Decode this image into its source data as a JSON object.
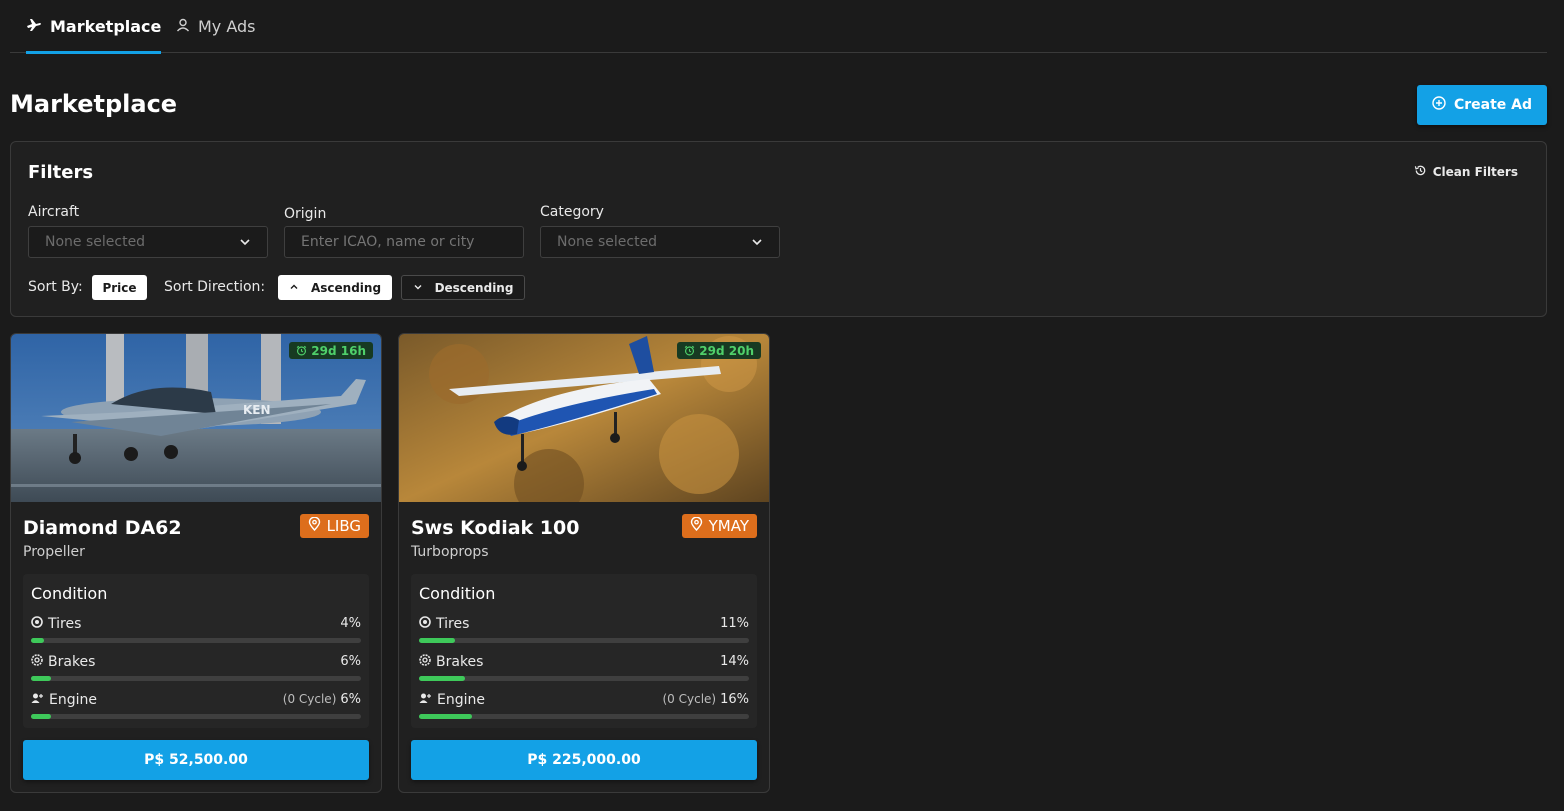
{
  "tabs": [
    {
      "label": "Marketplace",
      "icon": "plane-icon",
      "active": true
    },
    {
      "label": "My Ads",
      "icon": "user-icon",
      "active": false
    }
  ],
  "page": {
    "title": "Marketplace",
    "create_label": "Create Ad"
  },
  "filters": {
    "title": "Filters",
    "clean_label": "Clean Filters",
    "aircraft": {
      "label": "Aircraft",
      "value": "None selected"
    },
    "origin": {
      "label": "Origin",
      "placeholder": "Enter ICAO, name or city"
    },
    "category": {
      "label": "Category",
      "value": "None selected"
    },
    "sort_by_label": "Sort By:",
    "sort_by_value": "Price",
    "sort_direction_label": "Sort Direction:",
    "ascending_label": "Ascending",
    "descending_label": "Descending"
  },
  "listings": [
    {
      "name": "Diamond DA62",
      "category": "Propeller",
      "location": "LIBG",
      "time_left": "29d 16h",
      "condition_title": "Condition",
      "tires": {
        "label": "Tires",
        "percent": "4%",
        "value": 4
      },
      "brakes": {
        "label": "Brakes",
        "percent": "6%",
        "value": 6
      },
      "engine": {
        "label": "Engine",
        "cycle": "(0 Cycle)",
        "percent": "6%",
        "value": 6
      },
      "price": "P$ 52,500.00"
    },
    {
      "name": "Sws Kodiak 100",
      "category": "Turboprops",
      "location": "YMAY",
      "time_left": "29d 20h",
      "condition_title": "Condition",
      "tires": {
        "label": "Tires",
        "percent": "11%",
        "value": 11
      },
      "brakes": {
        "label": "Brakes",
        "percent": "14%",
        "value": 14
      },
      "engine": {
        "label": "Engine",
        "cycle": "(0 Cycle)",
        "percent": "16%",
        "value": 16
      },
      "price": "P$ 225,000.00"
    }
  ],
  "colors": {
    "accent": "#13a1e6",
    "location_badge": "#dd6e1c",
    "progress": "#3ec95a",
    "timer_text": "#4fd06a"
  }
}
